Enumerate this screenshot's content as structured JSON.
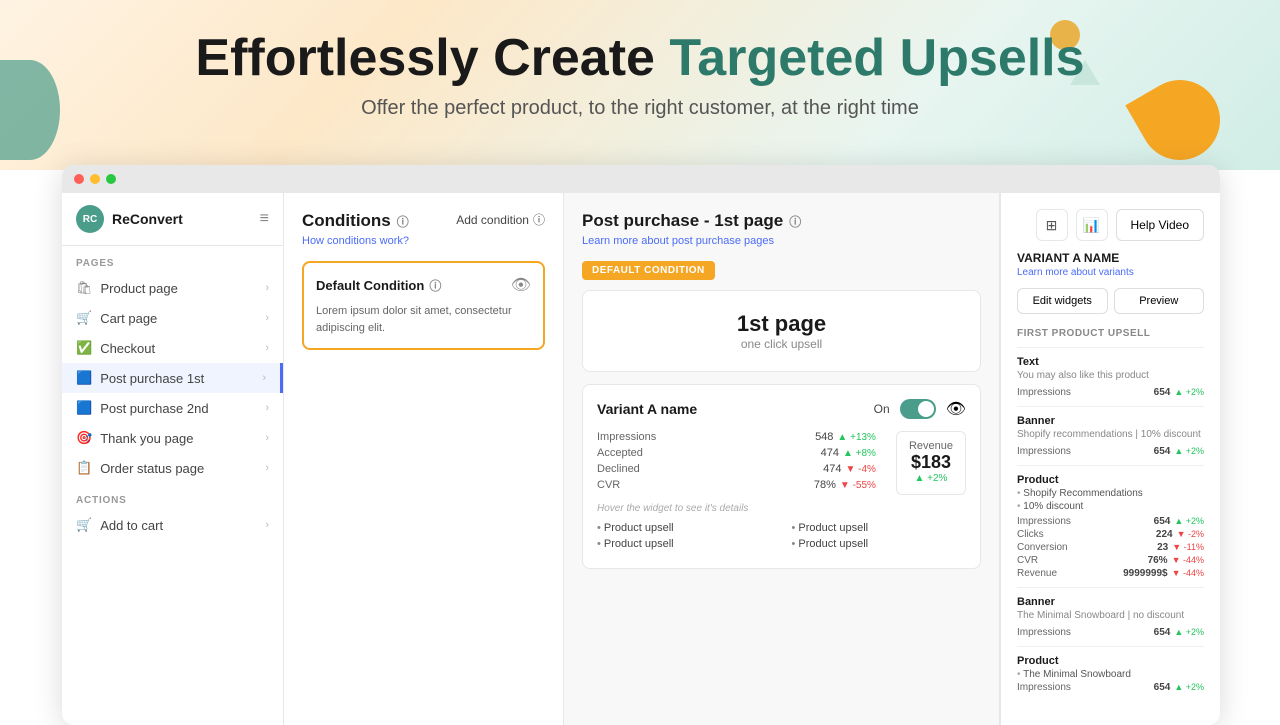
{
  "header": {
    "title_black": "Effortlessly Create ",
    "title_teal": "Targeted Upsells",
    "subtitle": "Offer the perfect product, to the right customer, at the right time"
  },
  "browser": {
    "dots": [
      "red",
      "yellow",
      "green"
    ]
  },
  "sidebar": {
    "logo": "ReConvert",
    "sections": [
      {
        "label": "PAGES",
        "items": [
          {
            "icon": "🛍",
            "label": "Product page",
            "chevron": true,
            "active": false
          },
          {
            "icon": "🛒",
            "label": "Cart page",
            "chevron": true,
            "active": false
          },
          {
            "icon": "✅",
            "label": "Checkout",
            "chevron": true,
            "active": false
          },
          {
            "icon": "🟦",
            "label": "Post purchase 1st",
            "chevron": true,
            "active": true
          },
          {
            "icon": "🟦",
            "label": "Post purchase 2nd",
            "chevron": true,
            "active": false
          },
          {
            "icon": "🎯",
            "label": "Thank you page",
            "chevron": true,
            "active": false
          },
          {
            "icon": "📋",
            "label": "Order status page",
            "chevron": true,
            "active": false
          }
        ]
      },
      {
        "label": "ACTIONS",
        "items": [
          {
            "icon": "🛒",
            "label": "Add to cart",
            "chevron": true,
            "active": false
          }
        ]
      }
    ]
  },
  "conditions": {
    "title": "Conditions",
    "info_icon": "ⓘ",
    "add_condition": "Add condition",
    "how_link": "How conditions work?",
    "card": {
      "title": "Default Condition",
      "info_icon": "ⓘ",
      "body": "Lorem ipsum dolor sit amet, consectetur adipiscing elit."
    }
  },
  "post_purchase": {
    "title": "Post purchase - 1st page",
    "info_icon": "ⓘ",
    "learn_link": "Learn more about post purchase pages",
    "badge": "DEFAULT CONDITION",
    "page_title": "1st page",
    "page_sub": "one click upsell",
    "variant": {
      "name": "Variant A name",
      "on_label": "On",
      "stats": {
        "impressions": {
          "label": "Impressions",
          "value": "548",
          "change": "+13%",
          "up": true
        },
        "accepted": {
          "label": "Accepted",
          "value": "474",
          "change": "+8%",
          "up": true
        },
        "declined": {
          "label": "Declined",
          "value": "474",
          "change": "-4%",
          "up": false
        },
        "cvr": {
          "label": "CVR",
          "value": "78%",
          "change": "-55%",
          "up": false
        }
      },
      "revenue": {
        "label": "Revenue",
        "value": "$183",
        "change": "+2%"
      },
      "hover_note": "Hover the widget to see it's details",
      "bullets_left": [
        "Product upsell",
        "Product upsell"
      ],
      "bullets_right": [
        "Product upsell",
        "Product upsell"
      ]
    }
  },
  "right_sidebar": {
    "variant_name_section": "VARIANT A NAME",
    "learn_link": "Learn more about variants",
    "buttons": {
      "edit": "Edit widgets",
      "preview": "Preview"
    },
    "first_product_upsell": "FIRST PRODUCT UPSELL",
    "help_video": "Help Video",
    "widgets": [
      {
        "type": "Text",
        "sub": "You may also like this product",
        "stats": [
          {
            "label": "Impressions",
            "value": "654",
            "change": "+2%",
            "up": true
          }
        ]
      },
      {
        "type": "Banner",
        "sub": "Shopify recommendations | 10% discount",
        "stats": [
          {
            "label": "Impressions",
            "value": "654",
            "change": "+2%",
            "up": true
          }
        ]
      },
      {
        "type": "Product",
        "sub": null,
        "products": [
          "Shopify Recommendations",
          "10% discount"
        ],
        "stats": [
          {
            "label": "Impressions",
            "value": "654",
            "change": "+2%",
            "up": true
          },
          {
            "label": "Clicks",
            "value": "224",
            "change": "-2%",
            "up": false
          },
          {
            "label": "Conversion",
            "value": "23",
            "change": "-11%",
            "up": false
          },
          {
            "label": "CVR",
            "value": "76%",
            "change": "-44%",
            "up": false
          },
          {
            "label": "Revenue",
            "value": "9999999$",
            "change": "-44%",
            "up": false
          }
        ]
      },
      {
        "type": "Banner",
        "sub": "The Minimal Snowboard | no discount",
        "stats": [
          {
            "label": "Impressions",
            "value": "654",
            "change": "+2%",
            "up": true
          }
        ]
      },
      {
        "type": "Product",
        "sub": null,
        "products": [
          "The Minimal Snowboard"
        ],
        "stats": [
          {
            "label": "Impressions",
            "value": "654",
            "change": "+2%",
            "up": true
          }
        ]
      }
    ]
  }
}
